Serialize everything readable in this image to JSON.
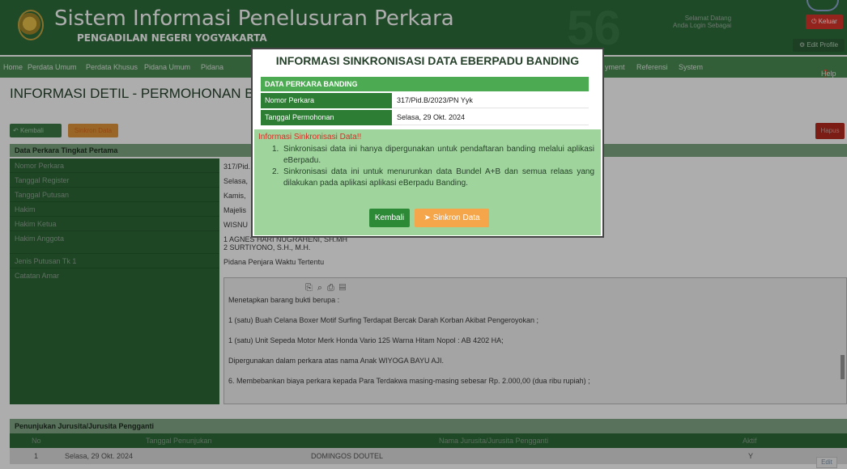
{
  "header": {
    "title": "Sistem Informasi Penelusuran Perkara",
    "subtitle": "PENGADILAN NEGERI YOGYAKARTA",
    "greeting_line1": "Selamat Datang",
    "greeting_line2": "Anda Login Sebagai",
    "logout_label": "Keluar",
    "edit_profile_label": "Edit Profile",
    "bg_number": "56"
  },
  "nav": {
    "items": [
      "Home",
      "Perdata Umum",
      "Perdata Khusus",
      "Pidana Umum",
      "Pidana",
      "yment",
      "Referensi",
      "System"
    ],
    "help_label": "Help"
  },
  "page": {
    "title": "INFORMASI DETIL - PERMOHONAN BANDI",
    "back_label": "Kembali",
    "sync_label": "Sinkron Data",
    "delete_label": "Hapus",
    "section_title": "Data Perkara Tingkat Pertama"
  },
  "details": [
    {
      "label": "Nomor Perkara",
      "value": "317/Pid."
    },
    {
      "label": "Tanggal Register",
      "value": "Selasa,"
    },
    {
      "label": "Tanggal Putusan",
      "value": "Kamis,"
    },
    {
      "label": "Hakim",
      "value": "Majelis"
    },
    {
      "label": "Hakim Ketua",
      "value": "WISNU"
    },
    {
      "label": "Hakim Anggota",
      "value": "1 AGNES HARI NUGRAHENI, SH.MH"
    },
    {
      "label": "Jenis Putusan Tk 1",
      "value": "Pidana Penjara Waktu Tertentu"
    },
    {
      "label": "Catatan Amar",
      "value": ""
    }
  ],
  "hakim_anggota_2": "2 SURTIYONO, S.H., M.H.",
  "amar": [
    "Menetapkan barang bukti berupa :",
    "1 (satu) Buah Celana Boxer Motif Surfing Terdapat Bercak Darah Korban Akibat Pengeroyokan ;",
    "1 (satu) Unit Sepeda Motor Merk Honda Vario 125 Warna Hitam Nopol : AB 4202 HA;",
    "Dipergunakan dalam perkara atas nama Anak WIYOGA BAYU AJI.",
    "6. Membebankan biaya perkara kepada  Para Terdakwa masing-masing sebesar Rp. 2.000,00 (dua ribu rupiah) ;"
  ],
  "jurusita": {
    "section_title": "Penunjukan Jurusita/Jurusita Pengganti",
    "headers": [
      "No",
      "Tanggal Penunjukan",
      "Nama Jurusita/Jurusita Pengganti",
      "Aktif"
    ],
    "row": {
      "no": "1",
      "date": "Selasa, 29 Okt. 2024",
      "name": "DOMINGOS DOUTEL",
      "active": "Y"
    },
    "edit_label": "Edit"
  },
  "modal": {
    "title": "INFORMASI SINKRONISASI DATA EBERPADU BANDING",
    "table_header": "DATA PERKARA BANDING",
    "rows": [
      {
        "label": "Nomor Perkara",
        "value": "317/Pid.B/2023/PN Yyk"
      },
      {
        "label": "Tanggal Permohonan",
        "value": "Selasa, 29 Okt. 2024"
      }
    ],
    "info_title": "Informasi Sinkronisasi Data!!",
    "info_items": [
      "Sinkronisasi data ini hanya dipergunakan untuk pendaftaran banding melalui aplikasi eBerpadu.",
      "Sinkronisasi data ini untuk menurunkan data Bundel A+B dan semua relaas yang dilakukan pada aplikasi aplikasi eBerpadu Banding."
    ],
    "back_label": "Kembali",
    "sync_label": "Sinkron Data"
  },
  "colors": {
    "header_green": "#2f6e3c",
    "nav_green": "#4a8b53",
    "modal_info_bg": "#9fd49d",
    "sync_orange": "#f5a54a"
  }
}
